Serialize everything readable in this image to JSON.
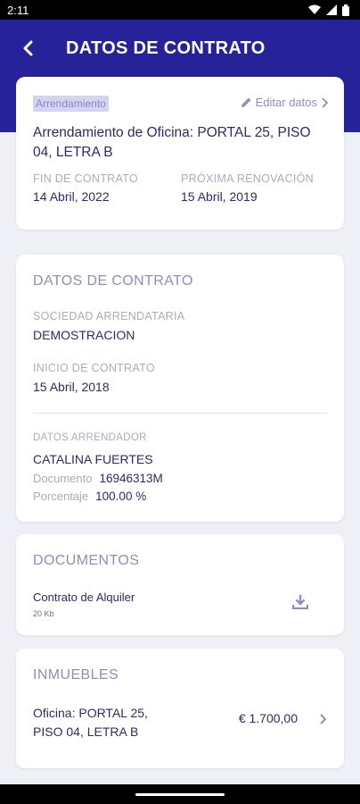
{
  "status_bar": {
    "time": "2:11"
  },
  "header": {
    "title": "DATOS DE CONTRATO"
  },
  "summary": {
    "tag": "Arrendamiento",
    "edit_label": "Editar datos",
    "contract_name": "Arrendamiento de Oficina: PORTAL 25, PISO 04, LETRA B",
    "end_label": "FIN DE CONTRATO",
    "end_value": "14 Abril, 2022",
    "renewal_label": "PRÓXIMA RENOVACIÓN",
    "renewal_value": "15 Abril, 2019"
  },
  "details": {
    "title": "DATOS DE CONTRATO",
    "company_label": "SOCIEDAD ARRENDATARIA",
    "company_value": "DEMOSTRACION",
    "start_label": "INICIO DE CONTRATO",
    "start_value": "15 Abril, 2018",
    "lessor_label": "DATOS ARRENDADOR",
    "lessor_name": "CATALINA FUERTES",
    "document_label": "Documento",
    "document_value": "16946313M",
    "percent_label": "Porcentaje",
    "percent_value": "100.00 %"
  },
  "documents": {
    "title": "DOCUMENTOS",
    "items": [
      {
        "name": "Contrato de Alquiler",
        "size": "20 Kb"
      }
    ]
  },
  "properties": {
    "title": "INMUEBLES",
    "items": [
      {
        "name": "Oficina: PORTAL 25, PISO 04, LETRA B",
        "price": "€ 1.700,00"
      }
    ]
  },
  "colors": {
    "header_bg": "#26239a",
    "accent": "#8e8dbd",
    "text": "#2a2c6b",
    "label": "#a9abc3",
    "background": "#eef0f6"
  },
  "icons": {
    "back": "arrow-left-icon",
    "edit": "pencil-icon",
    "chevron": "chevron-right-icon",
    "download": "download-icon"
  }
}
